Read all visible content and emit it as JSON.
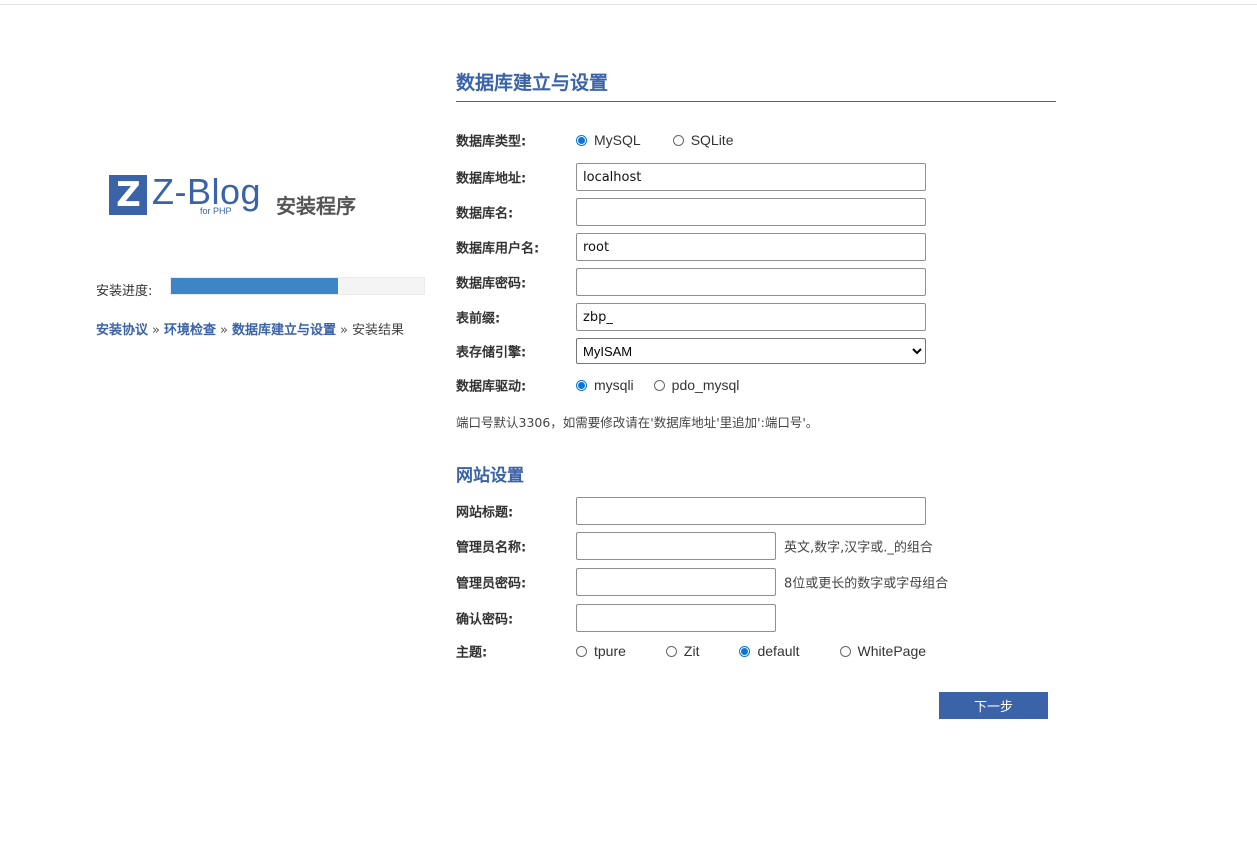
{
  "logo": {
    "mark": "Z",
    "name": "Z-Blog",
    "sub": "for PHP",
    "caption": "安装程序"
  },
  "progress": {
    "label": "安装进度:",
    "fraction": 0.66
  },
  "steps": [
    {
      "label": "安装协议",
      "done": true
    },
    {
      "label": "环境检查",
      "done": true
    },
    {
      "label": "数据库建立与设置",
      "done": true
    },
    {
      "label": "安装结果",
      "done": false
    }
  ],
  "steps_separator": "»",
  "db_section": {
    "title": "数据库建立与设置",
    "type_label": "数据库类型:",
    "type_options": [
      {
        "label": "MySQL",
        "checked": true
      },
      {
        "label": "SQLite",
        "checked": false
      }
    ],
    "host_label": "数据库地址:",
    "host_value": "localhost",
    "name_label": "数据库名:",
    "name_value": "",
    "user_label": "数据库用户名:",
    "user_value": "root",
    "password_label": "数据库密码:",
    "password_value": "",
    "prefix_label": "表前缀:",
    "prefix_value": "zbp_",
    "engine_label": "表存储引擎:",
    "engine_value": "MyISAM",
    "driver_label": "数据库驱动:",
    "driver_options": [
      {
        "label": "mysqli",
        "checked": true
      },
      {
        "label": "pdo_mysql",
        "checked": false
      }
    ],
    "note": "端口号默认3306，如需要修改请在'数据库地址'里追加':端口号'。"
  },
  "site_section": {
    "title": "网站设置",
    "site_title_label": "网站标题:",
    "site_title_value": "",
    "admin_name_label": "管理员名称:",
    "admin_name_value": "",
    "admin_name_hint": "英文,数字,汉字或._的组合",
    "admin_password_label": "管理员密码:",
    "admin_password_value": "",
    "admin_password_hint": "8位或更长的数字或字母组合",
    "confirm_password_label": "确认密码:",
    "confirm_password_value": "",
    "theme_label": "主题:",
    "theme_options": [
      {
        "label": "tpure",
        "checked": false
      },
      {
        "label": "Zit",
        "checked": false
      },
      {
        "label": "default",
        "checked": true
      },
      {
        "label": "WhitePage",
        "checked": false
      }
    ]
  },
  "next_button": "下一步",
  "colors": {
    "accent": "#3b63a8",
    "progress": "#3c86c8",
    "radio": "#0b74d8"
  }
}
